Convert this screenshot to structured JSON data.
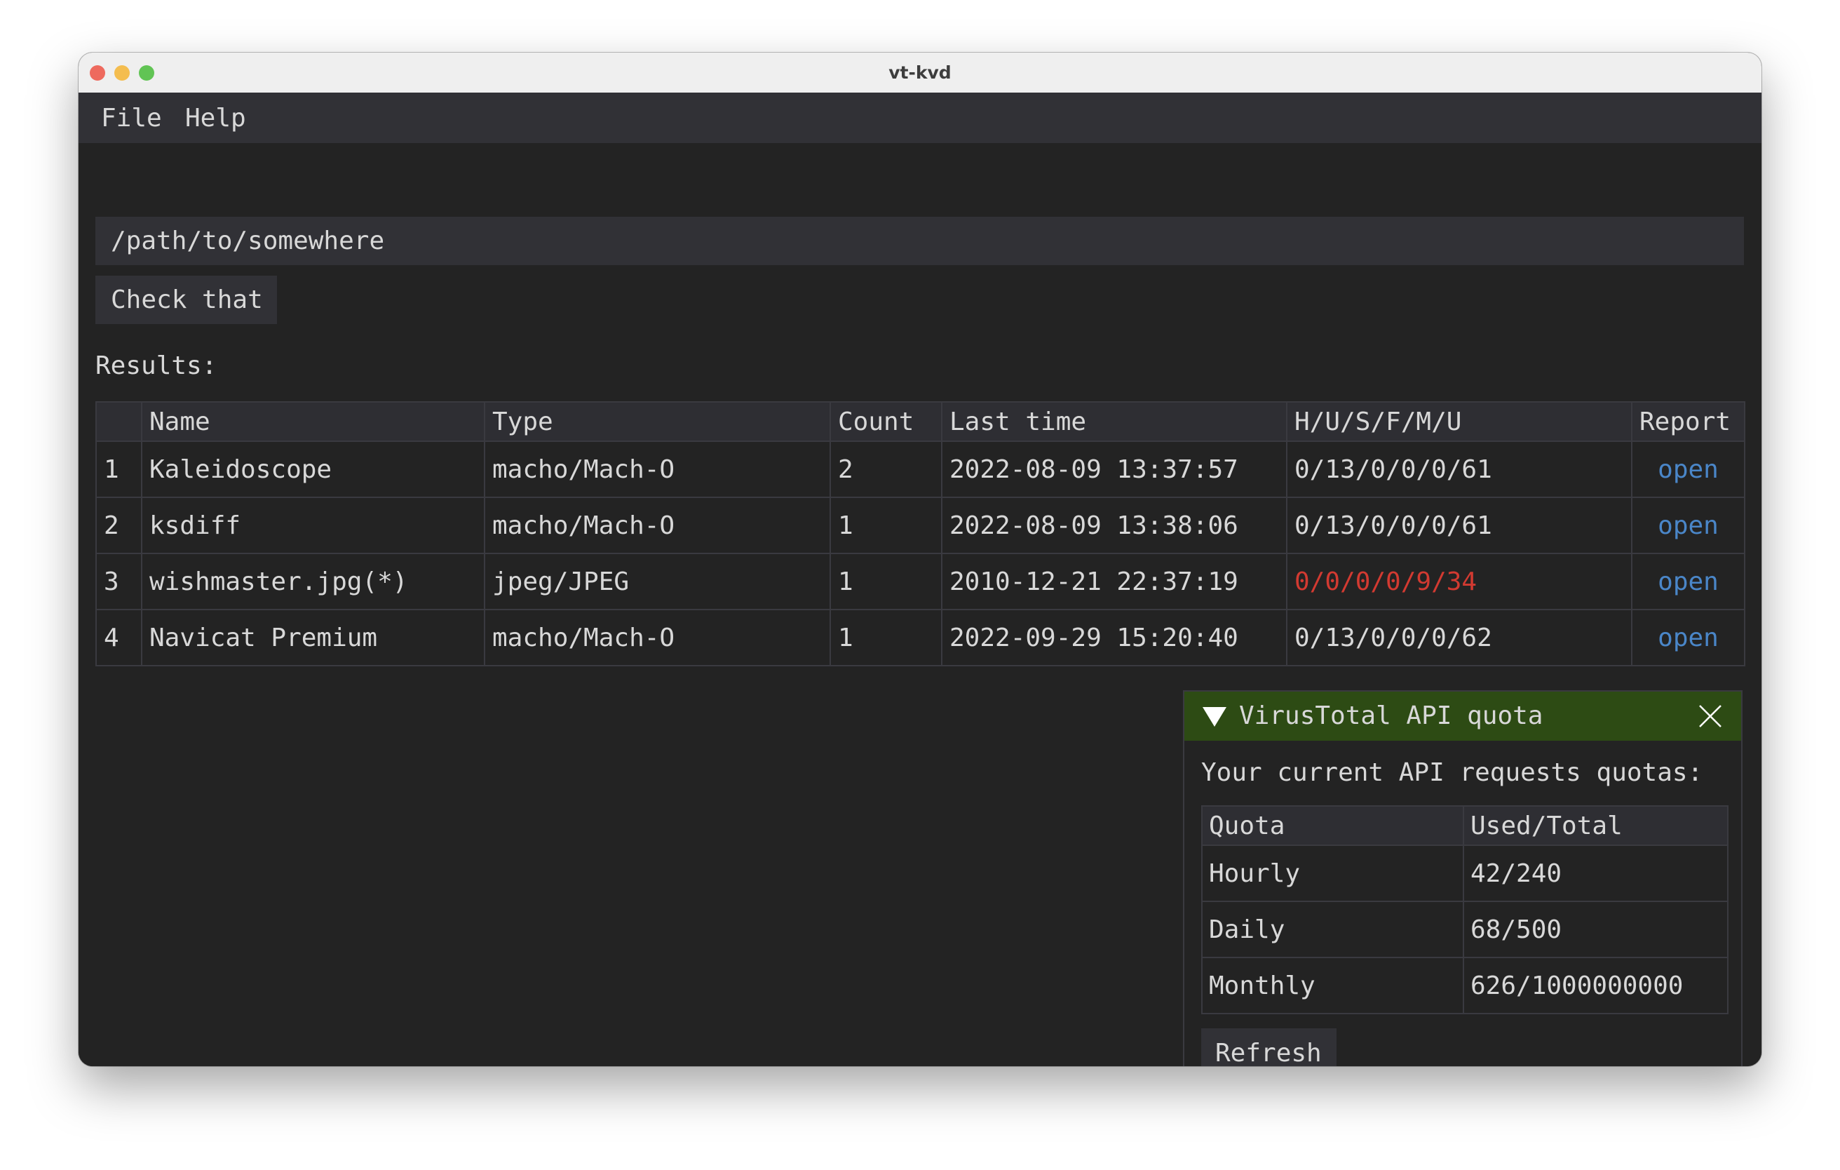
{
  "window": {
    "title": "vt-kvd"
  },
  "menu": {
    "items": [
      "File",
      "Help"
    ]
  },
  "path_input": {
    "value": "/path/to/somewhere"
  },
  "check_button": {
    "label": "Check that"
  },
  "results": {
    "label": "Results:",
    "columns": [
      "",
      "Name",
      "Type",
      "Count",
      "Last time",
      "H/U/S/F/M/U",
      "Report"
    ],
    "rows": [
      {
        "index": "1",
        "name": "Kaleidoscope",
        "type": "macho/Mach-O",
        "count": "2",
        "last_time": "2022-08-09 13:37:57",
        "stats": "0/13/0/0/0/61",
        "stats_alert": false,
        "report": "open"
      },
      {
        "index": "2",
        "name": "ksdiff",
        "type": "macho/Mach-O",
        "count": "1",
        "last_time": "2022-08-09 13:38:06",
        "stats": "0/13/0/0/0/61",
        "stats_alert": false,
        "report": "open"
      },
      {
        "index": "3",
        "name": "wishmaster.jpg(*)",
        "type": "jpeg/JPEG",
        "count": "1",
        "last_time": "2010-12-21 22:37:19",
        "stats": "0/0/0/0/9/34",
        "stats_alert": true,
        "report": "open"
      },
      {
        "index": "4",
        "name": "Navicat Premium",
        "type": "macho/Mach-O",
        "count": "1",
        "last_time": "2022-09-29 15:20:40",
        "stats": "0/13/0/0/0/62",
        "stats_alert": false,
        "report": "open"
      }
    ]
  },
  "quota_popup": {
    "title": "VirusTotal API quota",
    "description": "Your current API requests quotas:",
    "columns": [
      "Quota",
      "Used/Total"
    ],
    "rows": [
      {
        "quota": "Hourly",
        "used_total": "42/240"
      },
      {
        "quota": "Daily",
        "used_total": "68/500"
      },
      {
        "quota": "Monthly",
        "used_total": "626/1000000000"
      }
    ],
    "refresh_label": "Refresh"
  },
  "colors": {
    "accent_header": "#2d4b14",
    "link": "#4a86c8",
    "alert": "#d23a31",
    "background": "#232323",
    "panel": "#313136"
  }
}
